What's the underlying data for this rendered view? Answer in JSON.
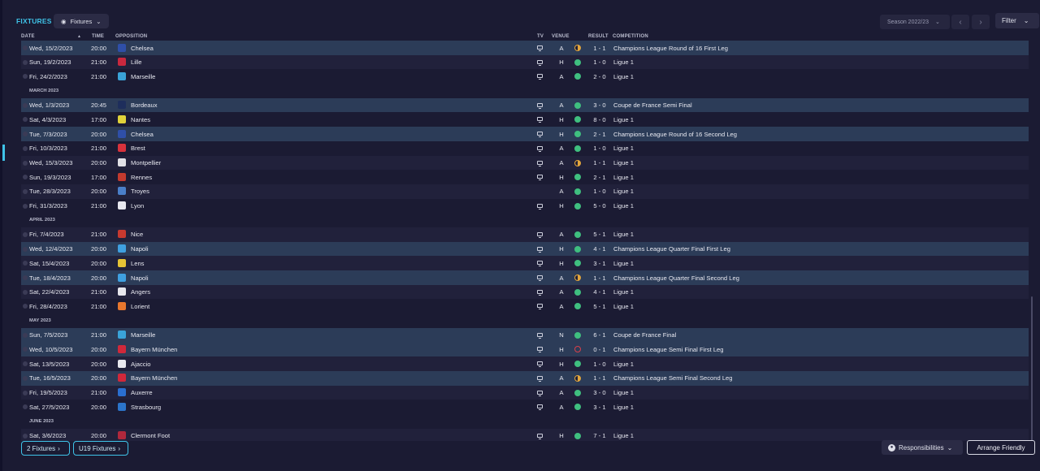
{
  "header": {
    "title": "FIXTURES",
    "view_label": "Fixtures",
    "season_label": "Season 2022/23",
    "filter_label": "Filter"
  },
  "columns": {
    "date": "DATE",
    "time": "TIME",
    "opposition": "OPPOSITION",
    "tv": "TV",
    "venue": "VENUE",
    "result": "RESULT",
    "competition": "COMPETITION"
  },
  "rows": [
    {
      "kind": "match",
      "date": "Wed, 15/2/2023",
      "time": "20:00",
      "opp": "Chelsea",
      "crest": "#2f4fa8",
      "tv": true,
      "venue": "A",
      "outcome": "draw",
      "score": "1 - 1",
      "comp": "Champions League Round of 16 First Leg",
      "style": "hl"
    },
    {
      "kind": "match",
      "date": "Sun, 19/2/2023",
      "time": "21:00",
      "opp": "Lille",
      "crest": "#c9283e",
      "tv": true,
      "venue": "H",
      "outcome": "win",
      "score": "1 - 0",
      "comp": "Ligue 1",
      "style": ""
    },
    {
      "kind": "match",
      "date": "Fri, 24/2/2023",
      "time": "21:00",
      "opp": "Marseille",
      "crest": "#3aa3d8",
      "tv": true,
      "venue": "A",
      "outcome": "win",
      "score": "2 - 0",
      "comp": "Ligue 1",
      "style": ""
    },
    {
      "kind": "month",
      "label": "MARCH 2023"
    },
    {
      "kind": "match",
      "date": "Wed, 1/3/2023",
      "time": "20:45",
      "opp": "Bordeaux",
      "crest": "#1e2e5c",
      "tv": true,
      "venue": "A",
      "outcome": "win",
      "score": "3 - 0",
      "comp": "Coupe de France Semi Final",
      "style": "hl"
    },
    {
      "kind": "match",
      "date": "Sat, 4/3/2023",
      "time": "17:00",
      "opp": "Nantes",
      "crest": "#e0d23a",
      "tv": true,
      "venue": "H",
      "outcome": "win",
      "score": "8 - 0",
      "comp": "Ligue 1",
      "style": ""
    },
    {
      "kind": "match",
      "date": "Tue, 7/3/2023",
      "time": "20:00",
      "opp": "Chelsea",
      "crest": "#2f4fa8",
      "tv": true,
      "venue": "H",
      "outcome": "win",
      "score": "2 - 1",
      "comp": "Champions League Round of 16 Second Leg",
      "style": "hl"
    },
    {
      "kind": "match",
      "date": "Fri, 10/3/2023",
      "time": "21:00",
      "opp": "Brest",
      "crest": "#d8323c",
      "tv": true,
      "venue": "A",
      "outcome": "win",
      "score": "1 - 0",
      "comp": "Ligue 1",
      "style": ""
    },
    {
      "kind": "match",
      "date": "Wed, 15/3/2023",
      "time": "20:00",
      "opp": "Montpellier",
      "crest": "#e0e0e6",
      "tv": true,
      "venue": "A",
      "outcome": "draw",
      "score": "1 - 1",
      "comp": "Ligue 1",
      "style": ""
    },
    {
      "kind": "match",
      "date": "Sun, 19/3/2023",
      "time": "17:00",
      "opp": "Rennes",
      "crest": "#c23a2e",
      "tv": true,
      "venue": "H",
      "outcome": "win",
      "score": "2 - 1",
      "comp": "Ligue 1",
      "style": ""
    },
    {
      "kind": "match",
      "date": "Tue, 28/3/2023",
      "time": "20:00",
      "opp": "Troyes",
      "crest": "#4a7fc8",
      "tv": false,
      "venue": "A",
      "outcome": "win",
      "score": "1 - 0",
      "comp": "Ligue 1",
      "style": ""
    },
    {
      "kind": "match",
      "date": "Fri, 31/3/2023",
      "time": "21:00",
      "opp": "Lyon",
      "crest": "#e8e8ef",
      "tv": true,
      "venue": "H",
      "outcome": "win",
      "score": "5 - 0",
      "comp": "Ligue 1",
      "style": ""
    },
    {
      "kind": "month",
      "label": "APRIL 2023"
    },
    {
      "kind": "match",
      "date": "Fri, 7/4/2023",
      "time": "21:00",
      "opp": "Nice",
      "crest": "#c7392f",
      "tv": true,
      "venue": "A",
      "outcome": "win",
      "score": "5 - 1",
      "comp": "Ligue 1",
      "style": ""
    },
    {
      "kind": "match",
      "date": "Wed, 12/4/2023",
      "time": "20:00",
      "opp": "Napoli",
      "crest": "#3fa0e0",
      "tv": true,
      "venue": "H",
      "outcome": "win",
      "score": "4 - 1",
      "comp": "Champions League Quarter Final First Leg",
      "style": "hl"
    },
    {
      "kind": "match",
      "date": "Sat, 15/4/2023",
      "time": "20:00",
      "opp": "Lens",
      "crest": "#e6c335",
      "tv": true,
      "venue": "H",
      "outcome": "win",
      "score": "3 - 1",
      "comp": "Ligue 1",
      "style": ""
    },
    {
      "kind": "match",
      "date": "Tue, 18/4/2023",
      "time": "20:00",
      "opp": "Napoli",
      "crest": "#3fa0e0",
      "tv": true,
      "venue": "A",
      "outcome": "draw",
      "score": "1 - 1",
      "comp": "Champions League Quarter Final Second Leg",
      "style": "hl"
    },
    {
      "kind": "match",
      "date": "Sat, 22/4/2023",
      "time": "21:00",
      "opp": "Angers",
      "crest": "#e6e6ec",
      "tv": true,
      "venue": "A",
      "outcome": "win",
      "score": "4 - 1",
      "comp": "Ligue 1",
      "style": ""
    },
    {
      "kind": "match",
      "date": "Fri, 28/4/2023",
      "time": "21:00",
      "opp": "Lorient",
      "crest": "#e8772e",
      "tv": true,
      "venue": "A",
      "outcome": "win",
      "score": "5 - 1",
      "comp": "Ligue 1",
      "style": ""
    },
    {
      "kind": "month",
      "label": "MAY 2023"
    },
    {
      "kind": "match",
      "date": "Sun, 7/5/2023",
      "time": "21:00",
      "opp": "Marseille",
      "crest": "#3aa3d8",
      "tv": true,
      "venue": "N",
      "outcome": "win",
      "score": "6 - 1",
      "comp": "Coupe de France Final",
      "style": "hl"
    },
    {
      "kind": "match",
      "date": "Wed, 10/5/2023",
      "time": "20:00",
      "opp": "Bayern München",
      "crest": "#d0283a",
      "tv": true,
      "venue": "H",
      "outcome": "loss",
      "score": "0 - 1",
      "comp": "Champions League Semi Final First Leg",
      "style": "hl"
    },
    {
      "kind": "match",
      "date": "Sat, 13/5/2023",
      "time": "20:00",
      "opp": "Ajaccio",
      "crest": "#e9e9ef",
      "tv": true,
      "venue": "H",
      "outcome": "win",
      "score": "1 - 0",
      "comp": "Ligue 1",
      "style": ""
    },
    {
      "kind": "match",
      "date": "Tue, 16/5/2023",
      "time": "20:00",
      "opp": "Bayern München",
      "crest": "#d0283a",
      "tv": true,
      "venue": "A",
      "outcome": "draw",
      "score": "1 - 1",
      "comp": "Champions League Semi Final Second Leg",
      "style": "hl"
    },
    {
      "kind": "match",
      "date": "Fri, 19/5/2023",
      "time": "21:00",
      "opp": "Auxerre",
      "crest": "#2a6fd0",
      "tv": true,
      "venue": "A",
      "outcome": "win",
      "score": "3 - 0",
      "comp": "Ligue 1",
      "style": ""
    },
    {
      "kind": "match",
      "date": "Sat, 27/5/2023",
      "time": "20:00",
      "opp": "Strasbourg",
      "crest": "#2b74c9",
      "tv": true,
      "venue": "A",
      "outcome": "win",
      "score": "3 - 1",
      "comp": "Ligue 1",
      "style": ""
    },
    {
      "kind": "month",
      "label": "JUNE 2023"
    },
    {
      "kind": "match",
      "date": "Sat, 3/6/2023",
      "time": "20:00",
      "opp": "Clermont Foot",
      "crest": "#b0283c",
      "tv": true,
      "venue": "H",
      "outcome": "win",
      "score": "7 - 1",
      "comp": "Ligue 1",
      "style": ""
    }
  ],
  "footer": {
    "fixtures2": "2 Fixtures",
    "u19": "U19 Fixtures",
    "responsibilities": "Responsibilities",
    "arrange": "Arrange Friendly"
  },
  "colors": {
    "accent": "#3fc3e8",
    "win": "#3fbf7f",
    "draw": "#e3a63c",
    "loss": "#d8404a"
  }
}
